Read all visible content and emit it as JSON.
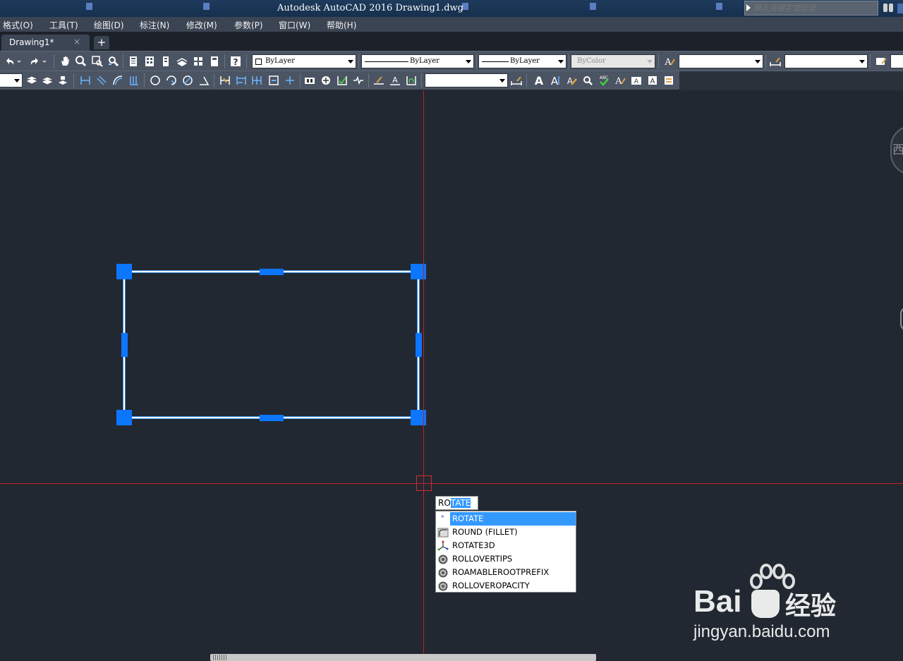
{
  "window": {
    "title": "Autodesk AutoCAD 2016    Drawing1.dwg",
    "search_placeholder": "键入关键字或短语"
  },
  "menubar": {
    "items": [
      "格式(O)",
      "工具(T)",
      "绘图(D)",
      "标注(N)",
      "修改(M)",
      "参数(P)",
      "窗口(W)",
      "帮助(H)"
    ]
  },
  "tabs": {
    "doc_tab": "Drawing1*",
    "close_glyph": "×",
    "new_tab_glyph": "+"
  },
  "properties_toolbar": {
    "color_value": "ByLayer",
    "linetype_value": "ByLayer",
    "lineweight_value": "ByLayer",
    "plotstyle_value": "ByColor"
  },
  "command": {
    "typed": "RO",
    "suggested_completion": "TATE"
  },
  "autocomplete": {
    "items": [
      {
        "label": "ROTATE",
        "icon": "rotate-icon",
        "selected": true
      },
      {
        "label": "ROUND (FILLET)",
        "icon": "fillet-icon",
        "selected": false
      },
      {
        "label": "ROTATE3D",
        "icon": "rotate3d-icon",
        "selected": false
      },
      {
        "label": "ROLLOVERTIPS",
        "icon": "gear-icon",
        "selected": false
      },
      {
        "label": "ROAMABLEROOTPREFIX",
        "icon": "gear-icon",
        "selected": false
      },
      {
        "label": "ROLLOVEROPACITY",
        "icon": "gear-icon",
        "selected": false
      }
    ]
  },
  "viewcube": {
    "label": "西"
  },
  "watermark": {
    "brand": "Bai",
    "suffix": "经验",
    "site": "jingyan.baidu.com"
  },
  "colors": {
    "canvas": "#222831",
    "crosshair": "#c0202a",
    "grip": "#0d76ff",
    "selection_highlight": "#3399ff"
  }
}
